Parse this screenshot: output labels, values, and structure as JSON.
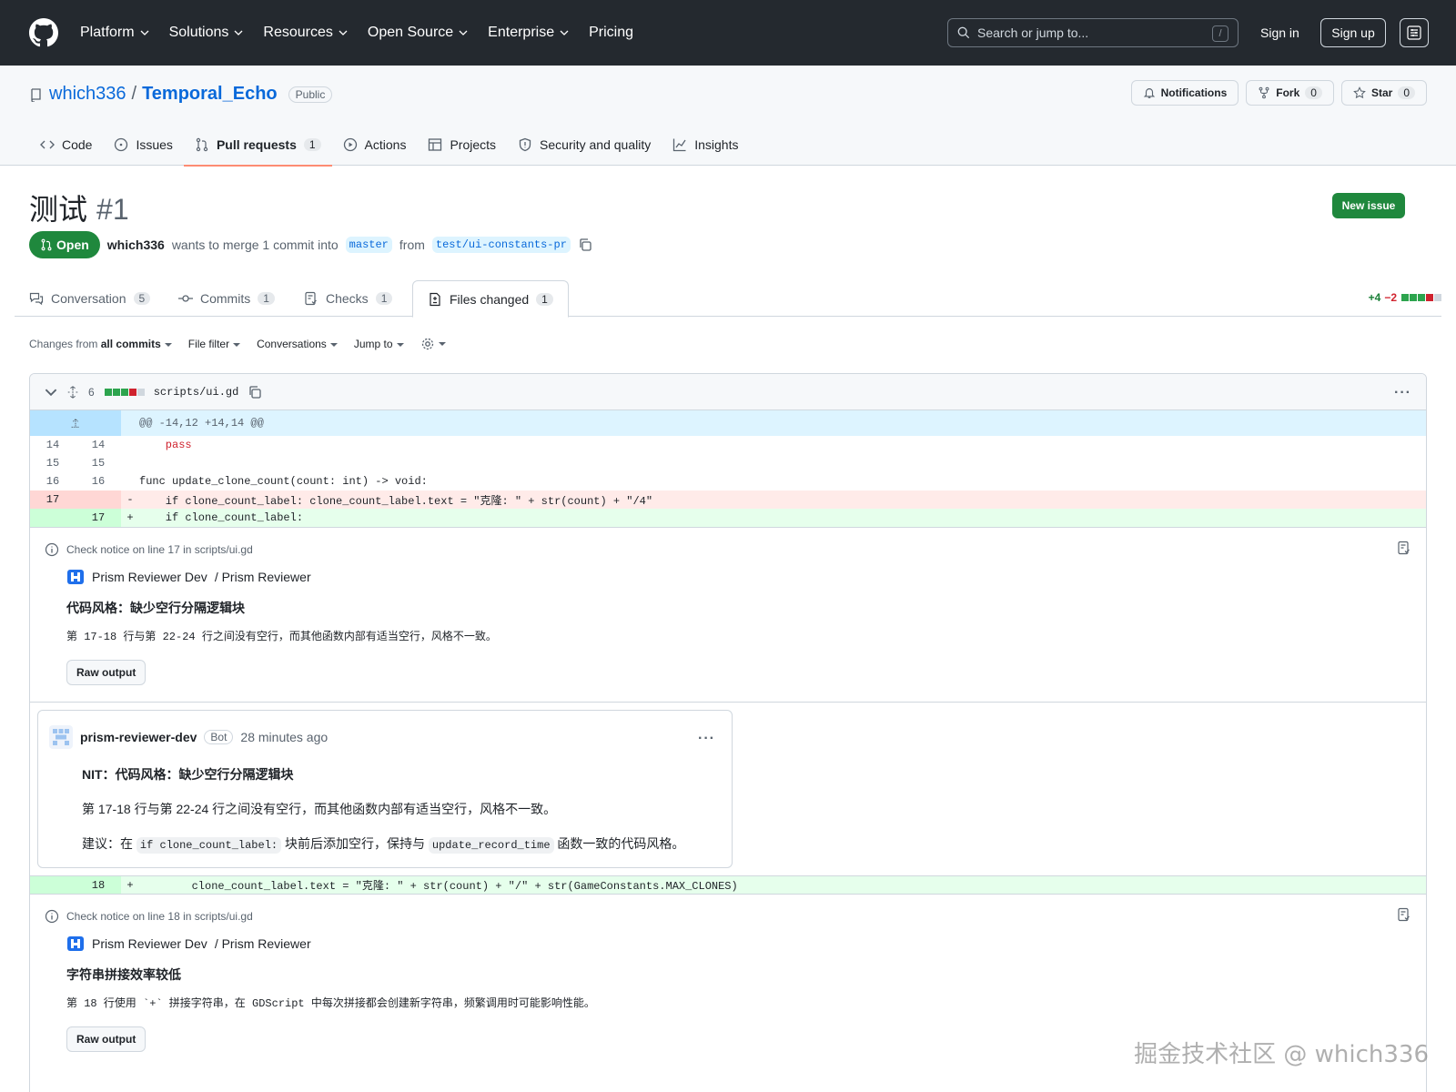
{
  "header": {
    "nav": [
      "Platform",
      "Solutions",
      "Resources",
      "Open Source",
      "Enterprise",
      "Pricing"
    ],
    "search_placeholder": "Search or jump to...",
    "search_key": "/",
    "sign_in": "Sign in",
    "sign_up": "Sign up"
  },
  "repo": {
    "owner": "which336",
    "separator": "/",
    "name": "Temporal_Echo",
    "visibility": "Public",
    "notifications": "Notifications",
    "fork_label": "Fork",
    "fork_count": "0",
    "star_label": "Star",
    "star_count": "0",
    "tabs": {
      "code": "Code",
      "issues": "Issues",
      "pulls": "Pull requests",
      "pulls_count": "1",
      "actions": "Actions",
      "projects": "Projects",
      "security": "Security and quality",
      "insights": "Insights"
    }
  },
  "pr": {
    "title": "测试",
    "number": "#1",
    "new_issue": "New issue",
    "state": "Open",
    "author": "which336",
    "merge_text": "wants to merge 1 commit into",
    "base_branch": "master",
    "from_text": "from",
    "head_branch": "test/ui-constants-pr",
    "tabs": {
      "conversation": "Conversation",
      "conversation_count": "5",
      "commits": "Commits",
      "commits_count": "1",
      "checks": "Checks",
      "checks_count": "1",
      "files": "Files changed",
      "files_count": "1"
    },
    "additions": "+4",
    "deletions": "−2"
  },
  "toolbar": {
    "changes_prefix": "Changes from",
    "changes_value": "all commits",
    "file_filter": "File filter",
    "conversations": "Conversations",
    "jump_to": "Jump to"
  },
  "file": {
    "changes": "6",
    "path": "scripts/ui.gd",
    "hunk": "@@ -14,12 +14,14 @@",
    "lines": [
      {
        "old": "14",
        "new": "14",
        "mark": "",
        "code": "    pass"
      },
      {
        "old": "15",
        "new": "15",
        "mark": "",
        "code": ""
      },
      {
        "old": "16",
        "new": "16",
        "mark": "",
        "code": "func update_clone_count(count: int) -> void:"
      },
      {
        "old": "17",
        "new": "",
        "mark": "-",
        "code": "    if clone_count_label: clone_count_label.text = \"克隆: \" + str(count) + \"/4\""
      },
      {
        "old": "",
        "new": "17",
        "mark": "+",
        "code": "    if clone_count_label:"
      },
      {
        "old": "",
        "new": "18",
        "mark": "+",
        "code": "        clone_count_label.text = \"克隆: \" + str(count) + \"/\" + str(GameConstants.MAX_CLONES)"
      }
    ]
  },
  "notices": [
    {
      "head": "Check notice on line 17 in scripts/ui.gd",
      "app": "Prism Reviewer Dev",
      "app_suffix": "/ Prism Reviewer",
      "title": "代码风格：缺少空行分隔逻辑块",
      "body": "第 17-18 行与第 22-24 行之间没有空行，而其他函数内部有适当空行，风格不一致。",
      "button": "Raw output"
    },
    {
      "head": "Check notice on line 18 in scripts/ui.gd",
      "app": "Prism Reviewer Dev",
      "app_suffix": "/ Prism Reviewer",
      "title": "字符串拼接效率较低",
      "body": "第 18 行使用 `+` 拼接字符串，在 GDScript 中每次拼接都会创建新字符串，频繁调用时可能影响性能。",
      "button": "Raw output"
    }
  ],
  "comment": {
    "author": "prism-reviewer-dev",
    "badge": "Bot",
    "time": "28 minutes ago",
    "p1": "NIT：代码风格：缺少空行分隔逻辑块",
    "p2": "第 17-18 行与第 22-24 行之间没有空行，而其他函数内部有适当空行，风格不一致。",
    "p3_pre": "建议：在",
    "p3_code1": "if clone_count_label:",
    "p3_mid": "块前后添加空行，保持与",
    "p3_code2": "update_record_time",
    "p3_post": "函数一致的代码风格。"
  },
  "watermark": "掘金技术社区 @ which336",
  "colors": {
    "header_bg": "#24292f",
    "open_green": "#1f883d",
    "link_blue": "#0969da",
    "add_bg": "#e6ffec",
    "del_bg": "#ffebe9",
    "tab_underline": "#fd8c73"
  }
}
